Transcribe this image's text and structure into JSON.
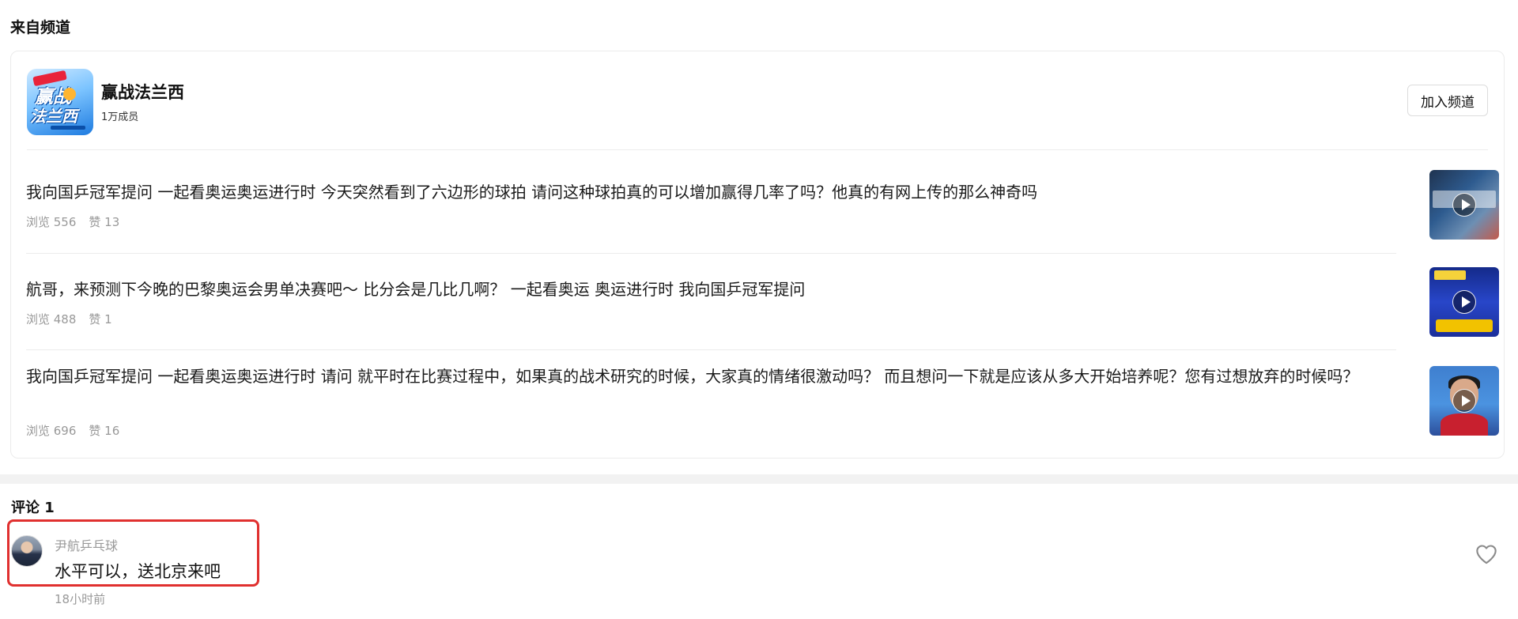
{
  "section_title": "来自频道",
  "channel": {
    "name": "赢战法兰西",
    "members": "1万成员",
    "join_label": "加入频道",
    "avatar_text_line1": "赢战",
    "avatar_text_line2": "法兰西"
  },
  "posts": [
    {
      "title": "我向国乒冠军提问 一起看奥运奥运进行时 今天突然看到了六边形的球拍 请问这种球拍真的可以增加赢得几率了吗？他真的有网上传的那么神奇吗",
      "views": "浏览 556",
      "likes": "赞 13"
    },
    {
      "title": "航哥，来预测下今晚的巴黎奥运会男单决赛吧～ 比分会是几比几啊？ 一起看奥运 奥运进行时 我向国乒冠军提问",
      "views": "浏览 488",
      "likes": "赞 1"
    },
    {
      "title": "我向国乒冠军提问 一起看奥运奥运进行时 请问 就平时在比赛过程中，如果真的战术研究的时候，大家真的情绪很激动吗？ 而且想问一下就是应该从多大开始培养呢？您有过想放弃的时候吗？",
      "views": "浏览 696",
      "likes": "赞 16"
    }
  ],
  "comments_title": "评论 1",
  "comment": {
    "author": "尹航乒乓球",
    "text": "水平可以，送北京来吧",
    "time": "18小时前"
  },
  "colors": {
    "highlight_border": "#e0302f",
    "muted_text": "#999999"
  },
  "icons": [
    "play-icon",
    "heart-icon"
  ]
}
